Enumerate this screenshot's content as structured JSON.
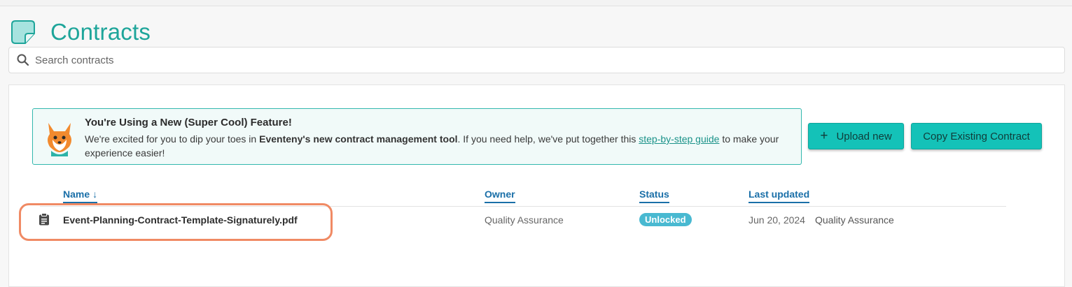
{
  "header": {
    "title": "Contracts",
    "logo_icon": "sticky-note-icon",
    "accent": "#1ea59a"
  },
  "search": {
    "placeholder": "Search contracts",
    "value": ""
  },
  "banner": {
    "title": "You're Using a New (Super Cool) Feature!",
    "body_pre": "We're excited for you to dip your toes in ",
    "body_bold": "Eventeny's new contract management tool",
    "body_mid": ". If you need help, we've put together this ",
    "link": "step-by-step guide",
    "body_post": " to make your experience easier!",
    "mascot_icon": "fox-mascot-icon"
  },
  "buttons": {
    "upload": "Upload new",
    "copy": "Copy Existing Contract"
  },
  "table": {
    "columns": {
      "name": "Name",
      "owner": "Owner",
      "status": "Status",
      "updated": "Last updated"
    },
    "sort_icon": "arrow-down-icon",
    "rows": [
      {
        "name": "Event-Planning-Contract-Template-Signaturely.pdf",
        "owner": "Quality Assurance",
        "status": "Unlocked",
        "date": "Jun 20, 2024",
        "updated_by": "Quality Assurance",
        "icon": "clipboard-icon"
      }
    ]
  },
  "colors": {
    "button": "#14c2b8",
    "link": "#1a6fa8",
    "badge": "#49b9d1",
    "highlight": "#f08a64"
  }
}
